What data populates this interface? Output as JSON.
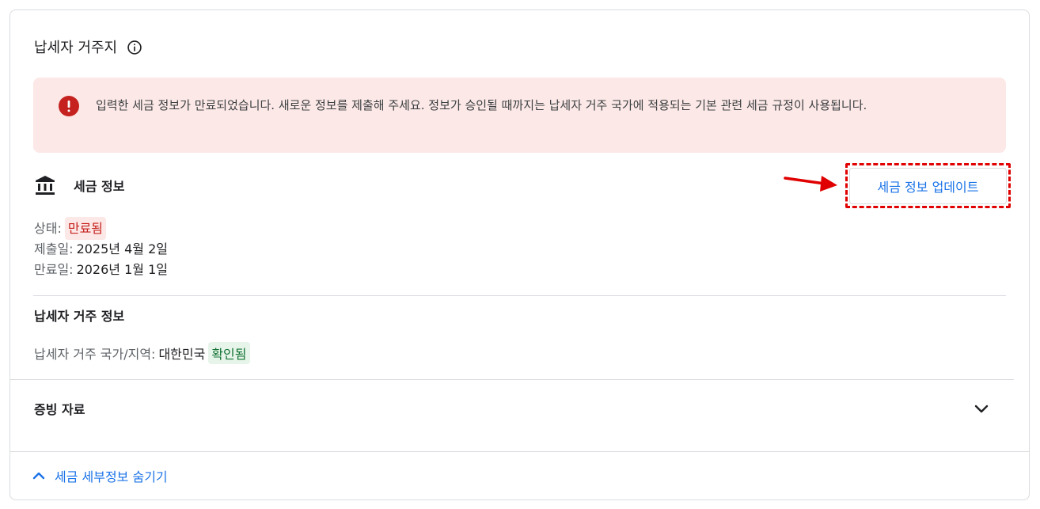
{
  "section": {
    "title": "납세자 거주지"
  },
  "alert": {
    "message": "입력한 세금 정보가 만료되었습니다. 새로운 정보를 제출해 주세요. 정보가 승인될 때까지는 납세자 거주 국가에 적용되는 기본 관련 세금 규정이 사용됩니다.",
    "color": "#fce8e6",
    "icon": "error-icon"
  },
  "tax_info": {
    "title": "세금 정보",
    "icon": "bank-icon",
    "update_button": "세금 정보 업데이트",
    "status_label": "상태:",
    "status_value": "만료됨",
    "submitted_label": "제출일:",
    "submitted_value": "2025년 4월 2일",
    "expires_label": "만료일:",
    "expires_value": "2026년 1월 1일"
  },
  "residency": {
    "title": "납세자 거주 정보",
    "country_label": "납세자 거주 국가/지역:",
    "country_value": "대한민국",
    "country_status": "확인됨"
  },
  "evidence": {
    "title": "증빙 자료"
  },
  "footer": {
    "hide_link": "세금 세부정보 숨기기"
  },
  "colors": {
    "accent": "#1a73e8",
    "error": "#c5221f",
    "success": "#137333",
    "highlight_border": "#e00000"
  }
}
